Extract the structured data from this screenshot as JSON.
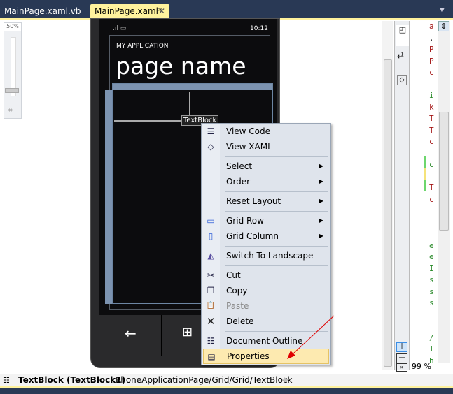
{
  "tabs": [
    {
      "label": "MainPage.xaml.vb",
      "active": false
    },
    {
      "label": "MainPage.xaml*",
      "active": true
    }
  ],
  "tab_close": "✕",
  "zoom_control": {
    "value": "50%"
  },
  "phone": {
    "time": "10:12",
    "app_title": "MY APPLICATION",
    "page_title": "page name",
    "selected_element": "TextBlock"
  },
  "context_menu": [
    {
      "label": "View Code",
      "icon": "view-code-icon",
      "glyph": "☰"
    },
    {
      "label": "View XAML",
      "icon": "view-xaml-icon",
      "glyph": "◇"
    },
    {
      "label": "Select",
      "submenu": true
    },
    {
      "label": "Order",
      "submenu": true
    },
    {
      "label": "Reset Layout",
      "submenu": true
    },
    {
      "label": "Grid Row",
      "icon": "grid-row-icon",
      "glyph": "▭",
      "submenu": true
    },
    {
      "label": "Grid Column",
      "icon": "grid-column-icon",
      "glyph": "▯",
      "submenu": true
    },
    {
      "label": "Switch To Landscape",
      "icon": "landscape-icon",
      "glyph": "◭"
    },
    {
      "label": "Cut",
      "icon": "scissors-icon",
      "glyph": "✂"
    },
    {
      "label": "Copy",
      "icon": "copy-icon",
      "glyph": "❐"
    },
    {
      "label": "Paste",
      "icon": "paste-icon",
      "glyph": "📋",
      "disabled": true
    },
    {
      "label": "Delete",
      "icon": "delete-icon",
      "glyph": "✕"
    },
    {
      "label": "Document Outline",
      "icon": "document-outline-icon",
      "glyph": "☷"
    },
    {
      "label": "Properties",
      "icon": "properties-icon",
      "glyph": "▤",
      "highlighted": true
    }
  ],
  "submenu_arrow": "▶",
  "code_lines": [
    "a",
    ".",
    "P",
    "P",
    "c",
    "",
    "i",
    "k",
    "T",
    "T",
    "c",
    "",
    "c",
    "",
    "T",
    "c",
    "",
    "",
    "",
    "e",
    "e",
    "I",
    "s",
    "s",
    "s",
    "",
    "",
    "/",
    "I",
    "h"
  ],
  "code_zoom": "99 %",
  "status_bar": {
    "element": "TextBlock (TextBlock1)",
    "path": "PhoneApplicationPage/Grid/Grid/TextBlock"
  },
  "colors": {
    "chrome": "#293955",
    "accent": "#fff29d",
    "menu_highlight": "#fdeab0",
    "annotation_arrow": "#e00000"
  }
}
